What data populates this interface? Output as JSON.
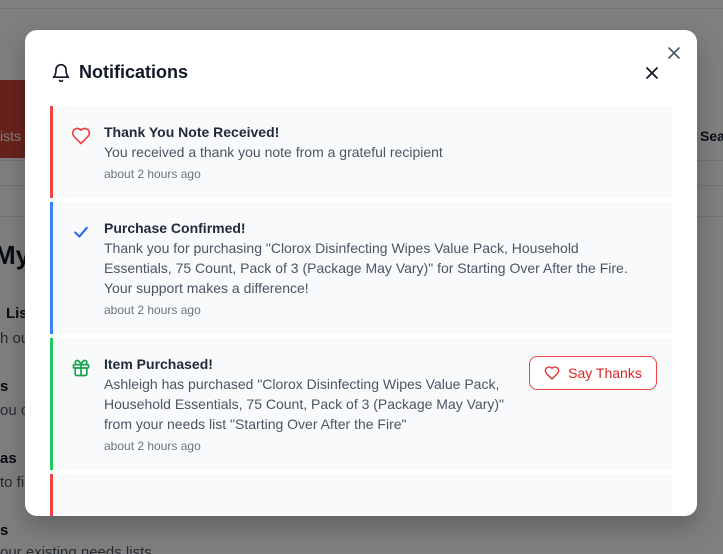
{
  "background": {
    "tab_label": "ists",
    "right_label": "Sea",
    "heading": "My",
    "lines": [
      {
        "text": "Lis",
        "style": "bold"
      },
      {
        "text": "h ou",
        "style": "muted"
      },
      {
        "text": "s",
        "style": "bold"
      },
      {
        "text": "ou c",
        "style": "muted"
      },
      {
        "text": "as",
        "style": "bold"
      },
      {
        "text": "to fi",
        "style": "muted"
      },
      {
        "text": "s",
        "style": "bold"
      },
      {
        "text": "our existing needs lists",
        "style": "muted"
      }
    ]
  },
  "modal": {
    "title": "Notifications",
    "icons": {
      "title": "bell-icon",
      "close": "close-icon"
    }
  },
  "notifications": [
    {
      "type": "thank_you",
      "accent": "#ef4444",
      "icon": "heart-icon",
      "title": "Thank You Note Received!",
      "message": "You received a thank you note from a grateful recipient",
      "time": "about 2 hours ago"
    },
    {
      "type": "purchase_confirmed",
      "accent": "#3b82f6",
      "icon": "check-icon",
      "title": "Purchase Confirmed!",
      "message": "Thank you for purchasing \"Clorox Disinfecting Wipes Value Pack, Household Essentials, 75 Count, Pack of 3 (Package May Vary)\" for Starting Over After the Fire. Your support makes a difference!",
      "time": "about 2 hours ago"
    },
    {
      "type": "item_purchased",
      "accent": "#22c55e",
      "icon": "gift-icon",
      "title": "Item Purchased!",
      "message": "Ashleigh has purchased \"Clorox Disinfecting Wipes Value Pack, Household Essentials, 75 Count, Pack of 3 (Package May Vary)\" from your needs list \"Starting Over After the Fire\"",
      "time": "about 2 hours ago",
      "action_label": "Say Thanks"
    },
    {
      "type": "thank_you",
      "accent": "#ef4444"
    }
  ]
}
